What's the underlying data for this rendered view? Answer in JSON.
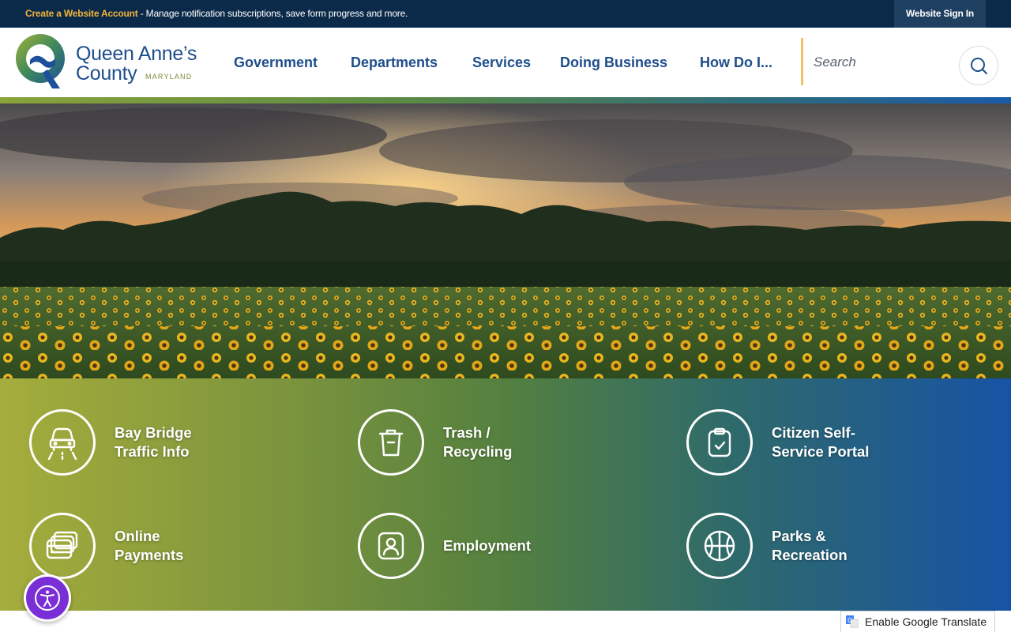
{
  "topbar": {
    "create_account": "Create a Website Account",
    "message": " - Manage notification subscriptions, save form progress and more.",
    "sign_in": "Website Sign In"
  },
  "logo": {
    "line1": "Queen Anne’s",
    "line2": "County",
    "state": "MARYLAND"
  },
  "nav": {
    "government": "Government",
    "departments": "Departments",
    "services": "Services",
    "doing_business": "Doing Business",
    "how_do_i": "How Do I..."
  },
  "search": {
    "placeholder": "Search"
  },
  "quick_links": [
    {
      "line1": "Bay Bridge",
      "line2": "Traffic Info",
      "icon": "car-icon"
    },
    {
      "line1": "Trash /",
      "line2": "Recycling",
      "icon": "trash-can-icon"
    },
    {
      "line1": "Citizen Self-",
      "line2": "Service Portal",
      "icon": "clipboard-check-icon"
    },
    {
      "line1": "Online",
      "line2": "Payments",
      "icon": "credit-cards-icon"
    },
    {
      "line1": "Employment",
      "line2": "",
      "icon": "person-badge-icon"
    },
    {
      "line1": "Parks &",
      "line2": "Recreation",
      "icon": "basketball-icon"
    }
  ],
  "translate": {
    "label": "Enable Google Translate"
  },
  "colors": {
    "topbar": "#0b2a4a",
    "brand_blue": "#1e4e8c",
    "accent_gold": "#f2b43a",
    "a11y_purple": "#7a2fd6"
  }
}
